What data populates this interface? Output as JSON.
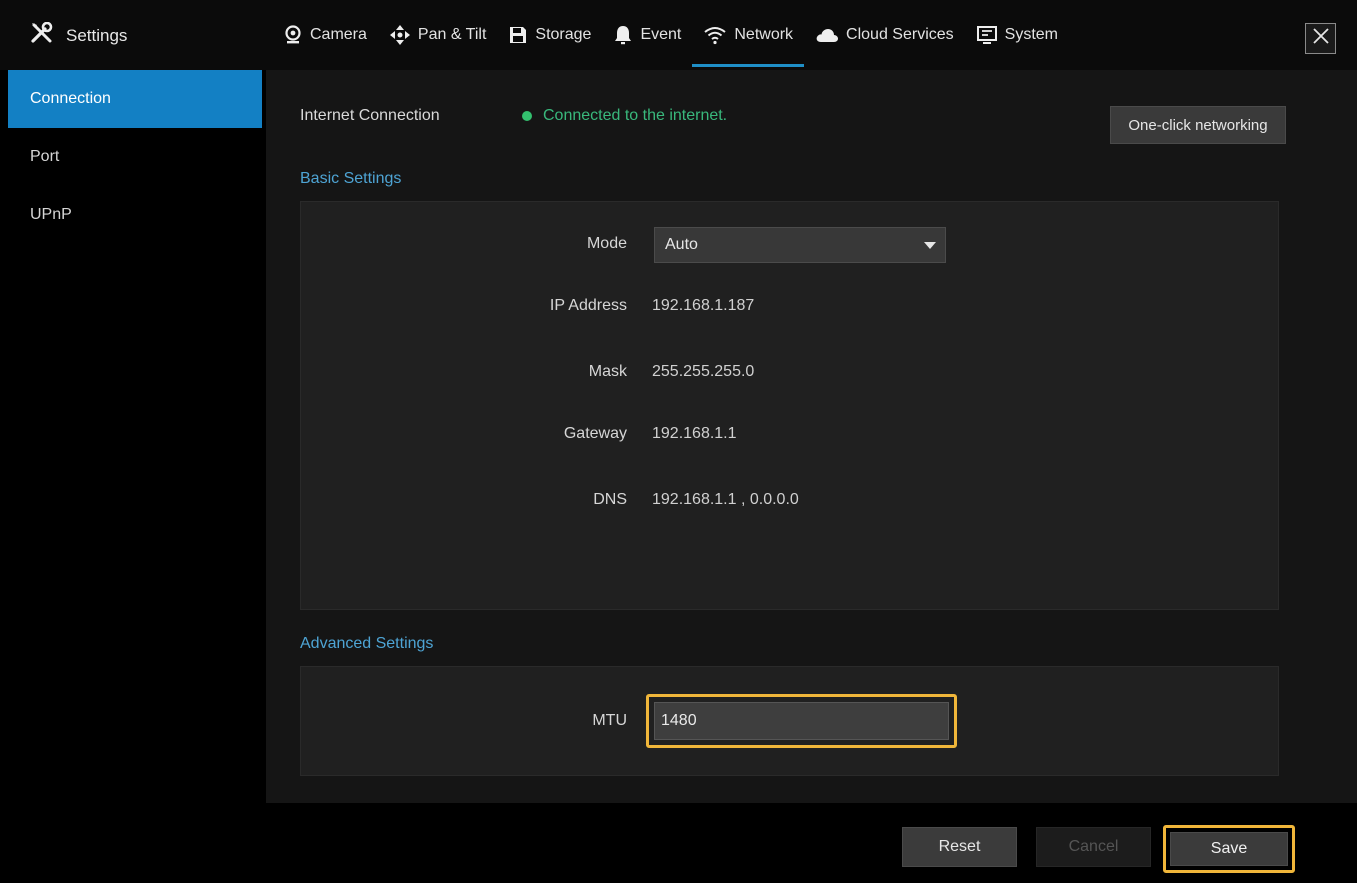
{
  "app": {
    "title": "Settings",
    "icon": "settings-tools-icon"
  },
  "tabs": [
    {
      "label": "Camera",
      "icon": "camera-icon"
    },
    {
      "label": "Pan & Tilt",
      "icon": "pan-tilt-icon"
    },
    {
      "label": "Storage",
      "icon": "storage-icon"
    },
    {
      "label": "Event",
      "icon": "bell-icon"
    },
    {
      "label": "Network",
      "icon": "wifi-icon",
      "active": true
    },
    {
      "label": "Cloud Services",
      "icon": "cloud-icon"
    },
    {
      "label": "System",
      "icon": "monitor-icon"
    }
  ],
  "sidebar": {
    "items": [
      {
        "label": "Connection",
        "active": true
      },
      {
        "label": "Port"
      },
      {
        "label": "UPnP"
      }
    ]
  },
  "internet": {
    "label": "Internet Connection",
    "status": "Connected to the internet.",
    "status_color": "#39b87c",
    "one_click": "One-click networking"
  },
  "basic": {
    "title": "Basic Settings",
    "mode_label": "Mode",
    "mode_value": "Auto",
    "ip_label": "IP Address",
    "ip_value": "192.168.1.187",
    "mask_label": "Mask",
    "mask_value": "255.255.255.0",
    "gateway_label": "Gateway",
    "gateway_value": "192.168.1.1",
    "dns_label": "DNS",
    "dns_value": "192.168.1.1 , 0.0.0.0"
  },
  "advanced": {
    "title": "Advanced Settings",
    "mtu_label": "MTU",
    "mtu_value": "1480"
  },
  "footer": {
    "reset": "Reset",
    "cancel": "Cancel",
    "save": "Save"
  },
  "colors": {
    "accent": "#1380c4",
    "section_title": "#4ea4d4",
    "highlight": "#f0b63a"
  }
}
